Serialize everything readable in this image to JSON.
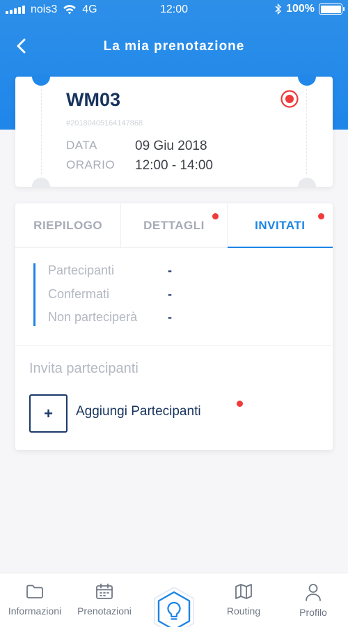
{
  "statusbar": {
    "carrier": "nois3",
    "network": "4G",
    "time": "12:00",
    "battery": "100%"
  },
  "header": {
    "title": "La mia prenotazione",
    "back_icon": "chevron-left-icon"
  },
  "booking": {
    "room": "WM03",
    "code": "#20180405164147868",
    "date_label": "DATA",
    "date_value": "09 Giu 2018",
    "time_label": "ORARIO",
    "time_value": "12:00 - 14:00",
    "status_icon": "target-icon",
    "accent_color": "#ef3b3b"
  },
  "tabs": [
    {
      "label": "RIEPILOGO",
      "active": false,
      "badge": false
    },
    {
      "label": "DETTAGLI",
      "active": false,
      "badge": true
    },
    {
      "label": "INVITATI",
      "active": true,
      "badge": true
    }
  ],
  "participants": {
    "rows": [
      {
        "label": "Partecipanti",
        "value": "-"
      },
      {
        "label": "Confermati",
        "value": "-"
      },
      {
        "label": "Non parteciperà",
        "value": "-"
      }
    ]
  },
  "invite": {
    "title": "Invita partecipanti",
    "add_button": "+",
    "add_label": "Aggiungi Partecipanti"
  },
  "nav": [
    {
      "label": "Informazioni",
      "icon": "folder-icon"
    },
    {
      "label": "Prenotazioni",
      "icon": "calendar-icon"
    },
    {
      "label": "",
      "icon": "lightbulb-icon"
    },
    {
      "label": "Routing",
      "icon": "map-icon"
    },
    {
      "label": "Profilo",
      "icon": "user-icon"
    }
  ],
  "colors": {
    "primary": "#1c84e6",
    "navy": "#17335e",
    "badge": "#ef3b3b"
  }
}
